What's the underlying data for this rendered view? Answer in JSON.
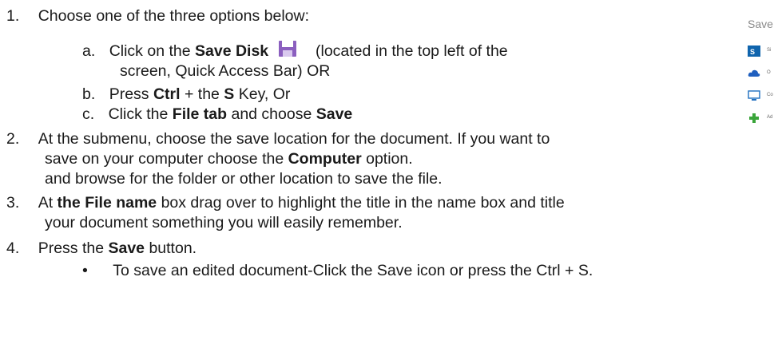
{
  "step1": {
    "num": "1.",
    "text": "Choose one of the three options below:",
    "a": {
      "letter": "a.",
      "pre": "Click on the ",
      "bold": "Save Disk",
      "post": "(located in the top left of the",
      "cont": "screen, Quick Access Bar) OR"
    },
    "b": {
      "letter": "b.",
      "pre": "Press ",
      "bold1": "Ctrl",
      "mid": " + the ",
      "bold2": "S",
      "post": " Key, Or"
    },
    "c": {
      "letter": "c.",
      "pre": "Click the ",
      "bold1": "File tab",
      "mid": " and choose ",
      "bold2": "Save"
    }
  },
  "step2": {
    "num": "2.",
    "line1": "At the submenu, choose the save location for the document. If you want to",
    "line2_pre": "save on your computer choose the ",
    "line2_bold": "Computer",
    "line2_post": " option.",
    "line3": "and browse for the folder or other location to save the file."
  },
  "step3": {
    "num": "3.",
    "pre": "At ",
    "bold": "the File name",
    "post": " box drag over to highlight the title in the name box and title",
    "line2": "your document something you will easily remember."
  },
  "step4": {
    "num": "4.",
    "pre": "Press the ",
    "bold": "Save",
    "post": " button.",
    "bullet": "To save an edited document-Click the Save icon or press the Ctrl + S."
  },
  "save_panel": {
    "title": "Save",
    "items": [
      {
        "icon": "sharepoint-icon",
        "label": "Si"
      },
      {
        "icon": "onedrive-icon",
        "label": "O"
      },
      {
        "icon": "computer-icon",
        "label": "Co"
      },
      {
        "icon": "add-place-icon",
        "label": "Ad"
      }
    ]
  },
  "colors": {
    "floppy": "#8b5fbf",
    "sharepoint": "#0f64ad",
    "onedrive": "#1f5fbf",
    "add": "#3aa53a"
  }
}
